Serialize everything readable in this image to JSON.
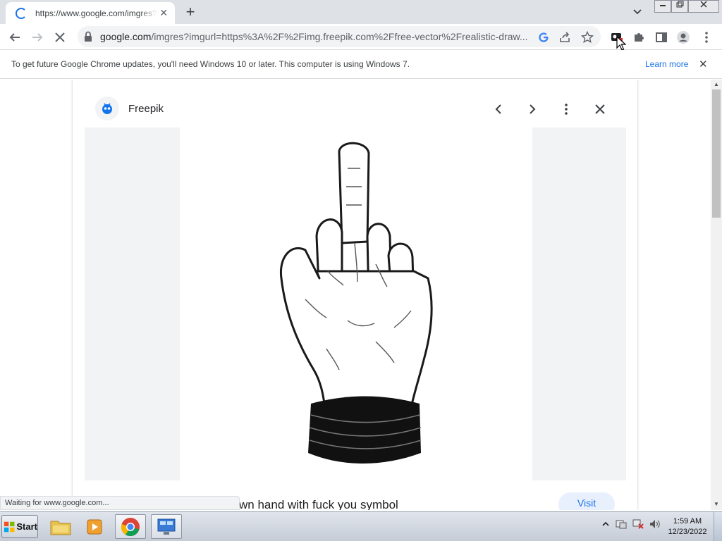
{
  "browser": {
    "tab": {
      "title": "https://www.google.com/imgres?imgurl=https",
      "close": "✕"
    },
    "new_tab": "+",
    "omnibox": {
      "url_host": "google.com",
      "url_rest": "/imgres?imgurl=https%3A%2F%2Fimg.freepik.com%2Ffree-vector%2Frealistic-draw..."
    },
    "infobar": {
      "message": "To get future Google Chrome updates, you'll need Windows 10 or later. This computer is using Windows 7.",
      "link": "Learn more",
      "close": "✕"
    },
    "status": "Waiting for www.google.com..."
  },
  "viewer": {
    "source_name": "Freepik",
    "caption": "wn hand with fuck you symbol",
    "visit_label": "Visit"
  },
  "taskbar": {
    "start_label": "Start",
    "time": "1:59 AM",
    "date": "12/23/2022"
  },
  "colors": {
    "accent": "#1a73e8",
    "tabstrip": "#dee1e6",
    "placeholder": "#f1f3f4"
  }
}
